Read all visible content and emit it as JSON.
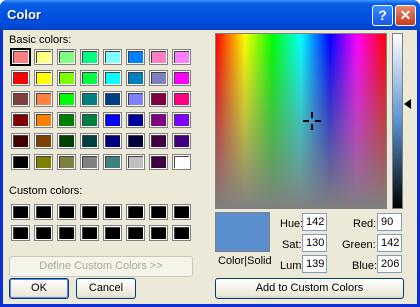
{
  "window": {
    "title": "Color"
  },
  "titlebar": {
    "help_label": "?",
    "close_label": "✕"
  },
  "labels": {
    "basic": "Basic colors:",
    "custom": "Custom colors:",
    "color_solid": "Color|Solid",
    "hue": "Hue:",
    "sat": "Sat:",
    "lum": "Lum:",
    "red": "Red:",
    "green": "Green:",
    "blue": "Blue:"
  },
  "basic_colors": [
    "#ff8080",
    "#ffff80",
    "#80ff80",
    "#00ff80",
    "#80ffff",
    "#0080ff",
    "#ff80c0",
    "#ff80ff",
    "#ff0000",
    "#ffff00",
    "#80ff00",
    "#00ff40",
    "#00ffff",
    "#0080c0",
    "#8080c0",
    "#ff00ff",
    "#804040",
    "#ff8040",
    "#00ff00",
    "#008080",
    "#004080",
    "#8080ff",
    "#800040",
    "#ff0080",
    "#800000",
    "#ff8000",
    "#008000",
    "#008040",
    "#0000ff",
    "#0000a0",
    "#800080",
    "#8000ff",
    "#400000",
    "#804000",
    "#004000",
    "#004040",
    "#000080",
    "#000040",
    "#400040",
    "#400080",
    "#000000",
    "#808000",
    "#808040",
    "#808080",
    "#408080",
    "#c0c0c0",
    "#400040",
    "#ffffff"
  ],
  "custom_colors": [
    "#000000",
    "#000000",
    "#000000",
    "#000000",
    "#000000",
    "#000000",
    "#000000",
    "#000000",
    "#000000",
    "#000000",
    "#000000",
    "#000000",
    "#000000",
    "#000000",
    "#000000",
    "#000000"
  ],
  "fields": {
    "hue": "142",
    "sat": "130",
    "lum": "139",
    "red": "90",
    "green": "142",
    "blue": "206"
  },
  "buttons": {
    "define_custom": "Define Custom Colors >>",
    "ok": "OK",
    "cancel": "Cancel",
    "add_custom": "Add to Custom Colors"
  },
  "selected_color": "#5a8ece"
}
